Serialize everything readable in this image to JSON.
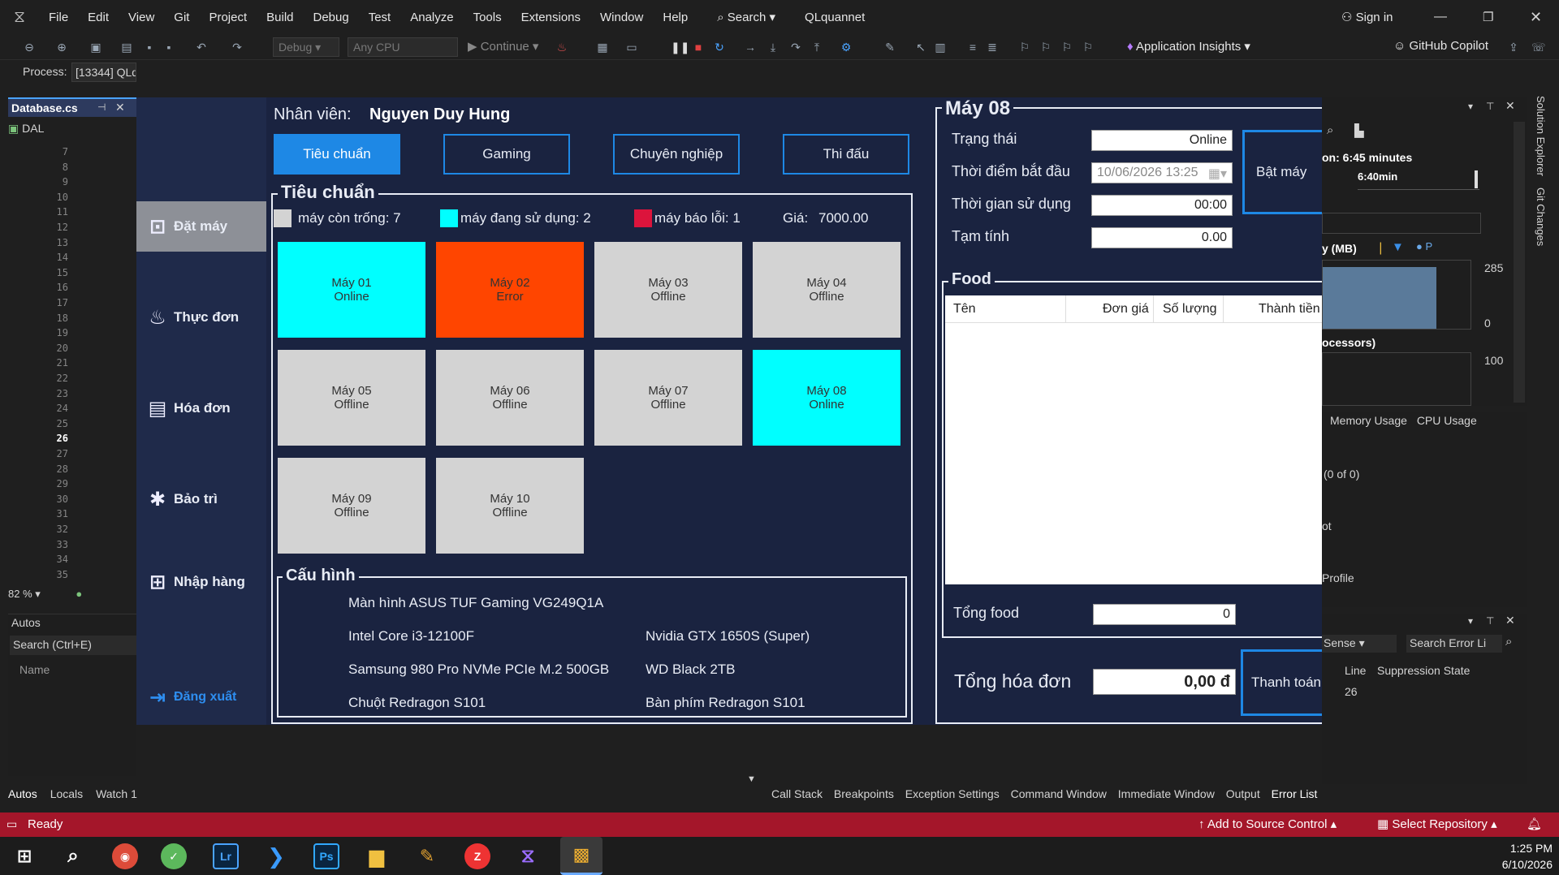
{
  "vs": {
    "menu": [
      "File",
      "Edit",
      "View",
      "Git",
      "Project",
      "Build",
      "Debug",
      "Test",
      "Analyze",
      "Tools",
      "Extensions",
      "Window",
      "Help"
    ],
    "search": "Search",
    "solution": "QLquannet",
    "sign_in": "Sign in",
    "config": "Debug",
    "platform": "Any CPU",
    "continue": "Continue",
    "app_insights": "Application Insights",
    "copilot": "GitHub Copilot",
    "process_label": "Process:",
    "process_value": "[13344] QLq",
    "file_tab": "Database.cs",
    "project": "DAL",
    "line_numbers": [
      "7",
      "8",
      "9",
      "10",
      "11",
      "12",
      "13",
      "14",
      "15",
      "16",
      "17",
      "18",
      "19",
      "20",
      "21",
      "22",
      "23",
      "24",
      "25",
      "26",
      "27",
      "28",
      "29",
      "30",
      "31",
      "32",
      "33",
      "34",
      "35"
    ],
    "zoom": "82 %",
    "autos": {
      "title": "Autos",
      "search": "Search (Ctrl+E)",
      "col": "Name"
    },
    "bottom_tabs_left": [
      "Autos",
      "Locals",
      "Watch 1"
    ],
    "bottom_tabs_right": [
      "Call Stack",
      "Breakpoints",
      "Exception Settings",
      "Command Window",
      "Immediate Window",
      "Output",
      "Error List"
    ],
    "diag": {
      "session": "on: 6:45 minutes",
      "time": "6:40min",
      "mem": "y (MB)",
      "mem_max": "285",
      "mem_min": "0",
      "cpu": "ocessors)",
      "cpu_max": "100",
      "tabs": [
        "Memory Usage",
        "CPU Usage"
      ],
      "count": "(0 of 0)",
      "snapshot": "ot",
      "profile": "Profile"
    },
    "errors": {
      "sense": "Sense",
      "search": "Search Error Li",
      "col_line": "Line",
      "col_state": "Suppression State",
      "line_val": "26"
    },
    "side_tabs": [
      "Solution Explorer",
      "Git Changes"
    ],
    "status": {
      "ready": "Ready",
      "source": "Add to Source Control",
      "repo": "Select Repository"
    },
    "clock": {
      "time": "1:25 PM",
      "date": "6/10/2026"
    }
  },
  "app": {
    "employee_label": "Nhân viên:",
    "employee_name": "Nguyen Duy Hung",
    "nav": [
      {
        "label": "Đặt máy",
        "icon": "computer-icon"
      },
      {
        "label": "Thực đơn",
        "icon": "menu-icon"
      },
      {
        "label": "Hóa đơn",
        "icon": "invoice-icon"
      },
      {
        "label": "Bảo trì",
        "icon": "maintenance-icon"
      },
      {
        "label": "Nhập hàng",
        "icon": "cart-icon"
      }
    ],
    "logout": "Đăng xuất",
    "tabs": [
      "Tiêu chuẩn",
      "Gaming",
      "Chuyên nghiệp",
      "Thi đấu"
    ],
    "group_title": "Tiêu chuẩn",
    "legend": {
      "free": "máy còn trống: 7",
      "used": "máy đang sử dụng: 2",
      "error": "máy báo lỗi: 1",
      "price_label": "Giá:",
      "price": "7000.00"
    },
    "machines": [
      {
        "name": "Máy 01",
        "status": "Online"
      },
      {
        "name": "Máy 02",
        "status": "Error"
      },
      {
        "name": "Máy 03",
        "status": "Offline"
      },
      {
        "name": "Máy 04",
        "status": "Offline"
      },
      {
        "name": "Máy 05",
        "status": "Offline"
      },
      {
        "name": "Máy 06",
        "status": "Offline"
      },
      {
        "name": "Máy 07",
        "status": "Offline"
      },
      {
        "name": "Máy 08",
        "status": "Online"
      },
      {
        "name": "Máy 09",
        "status": "Offline"
      },
      {
        "name": "Máy 10",
        "status": "Offline"
      }
    ],
    "config_title": "Cấu hình",
    "config": {
      "monitor": "Màn hình ASUS TUF Gaming VG249Q1A",
      "cpu": "Intel Core i3-12100F",
      "gpu": "Nvidia GTX 1650S (Super)",
      "ssd": "Samsung 980 Pro NVMe PCIe M.2 500GB",
      "hdd": "WD Black 2TB",
      "mouse": "Chuột Redragon S101",
      "keyboard": "Bàn phím Redragon S101"
    },
    "detail": {
      "title": "Máy 08",
      "status_label": "Trạng thái",
      "status": "Online",
      "start_label": "Thời điểm bắt đầu",
      "start": "10/06/2026 13:25",
      "used_label": "Thời gian sử dụng",
      "used": "00:00",
      "temp_label": "Tạm tính",
      "temp": "0.00",
      "turn_on": "Bật máy"
    },
    "food": {
      "title": "Food",
      "cols": [
        "Tên",
        "Đơn giá",
        "Số lượng",
        "Thành tiền"
      ],
      "total_label": "Tổng food",
      "total": "0"
    },
    "invoice": {
      "label": "Tổng hóa đơn",
      "total": "0,00 đ",
      "pay": "Thanh toán"
    }
  },
  "colors": {
    "online": "#00ffff",
    "error": "#ff4500",
    "offline": "#d3d3d3",
    "accent": "#1e88e5",
    "status_bar": "#a4162a"
  }
}
